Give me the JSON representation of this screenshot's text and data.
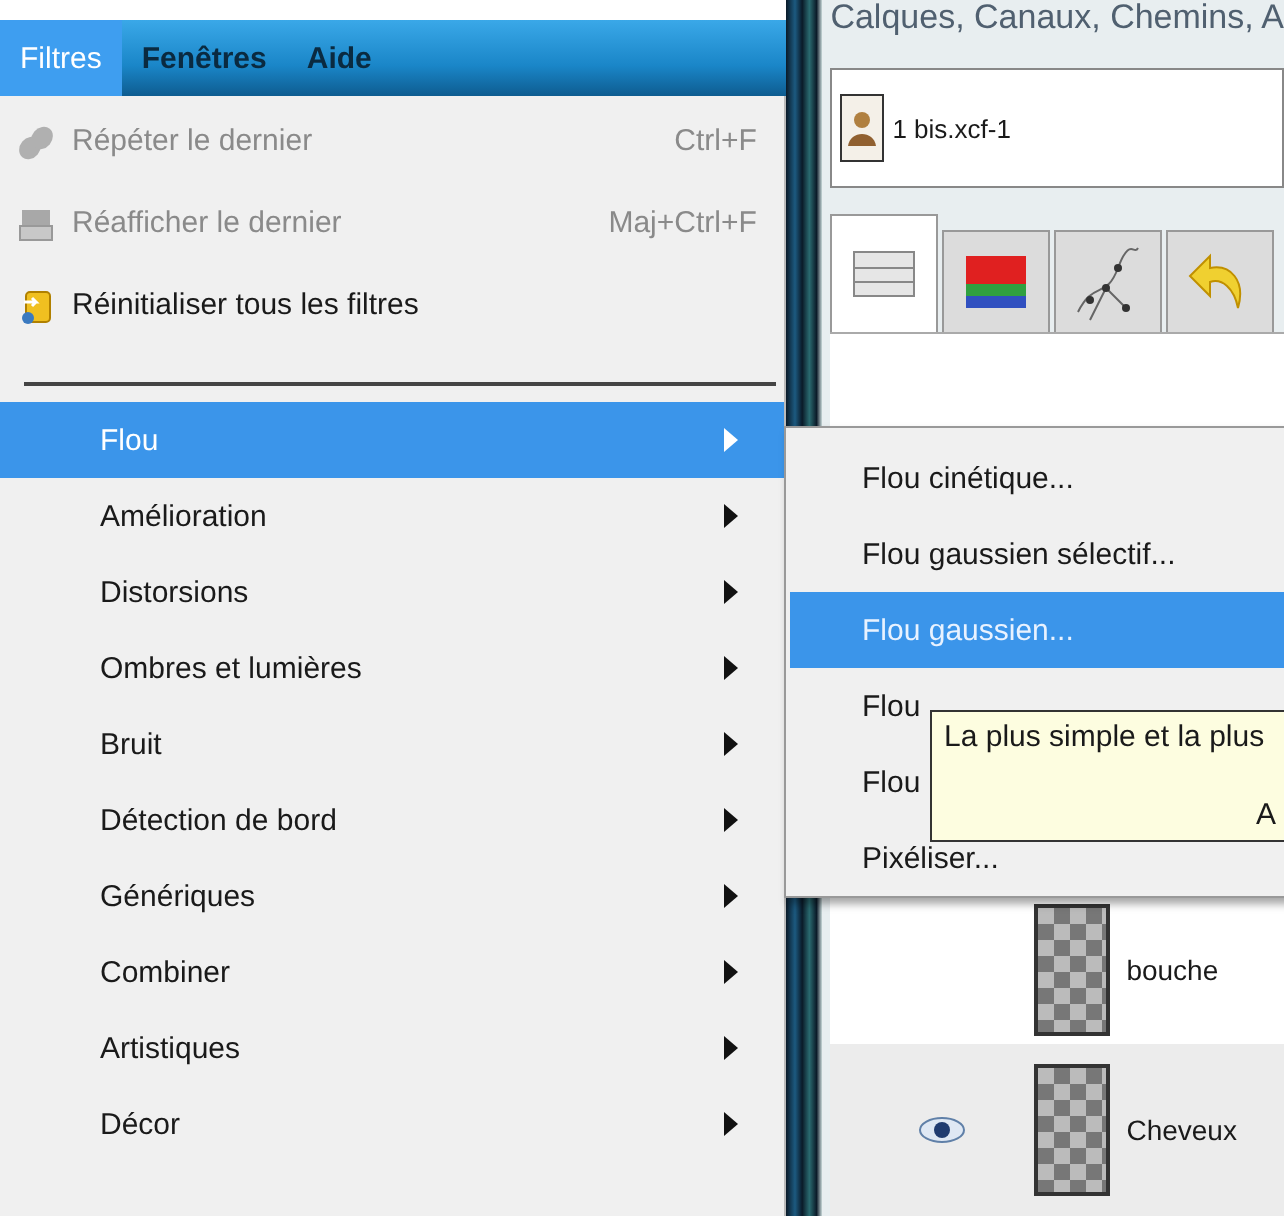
{
  "menubar": [
    {
      "label": "Filtres",
      "selected": true
    },
    {
      "label": "Fenêtres",
      "selected": false
    },
    {
      "label": "Aide",
      "selected": false
    }
  ],
  "menu": {
    "items": [
      {
        "kind": "command",
        "label": "Répéter le dernier",
        "shortcut": "Ctrl+F",
        "disabled": true
      },
      {
        "kind": "command",
        "label": "Réafficher le dernier",
        "shortcut": "Maj+Ctrl+F",
        "disabled": true
      },
      {
        "kind": "command",
        "label": "Réinitialiser tous les filtres",
        "disabled": false
      },
      {
        "kind": "separator"
      },
      {
        "kind": "submenu",
        "label": "Flou",
        "selected": true
      },
      {
        "kind": "submenu",
        "label": "Amélioration",
        "selected": false
      },
      {
        "kind": "submenu",
        "label": "Distorsions",
        "selected": false
      },
      {
        "kind": "submenu",
        "label": "Ombres et lumières",
        "selected": false
      },
      {
        "kind": "submenu",
        "label": "Bruit",
        "selected": false
      },
      {
        "kind": "submenu",
        "label": "Détection de bord",
        "selected": false
      },
      {
        "kind": "submenu",
        "label": "Génériques",
        "selected": false
      },
      {
        "kind": "submenu",
        "label": "Combiner",
        "selected": false
      },
      {
        "kind": "submenu",
        "label": "Artistiques",
        "selected": false
      },
      {
        "kind": "submenu",
        "label": "Décor",
        "selected": false
      }
    ]
  },
  "submenu": {
    "items": [
      {
        "label": "Flou cinétique...",
        "selected": false
      },
      {
        "label": "Flou gaussien sélectif...",
        "selected": false
      },
      {
        "label": "Flou gaussien...",
        "selected": true
      },
      {
        "label": "Flou",
        "selected": false
      },
      {
        "label": "Flou",
        "selected": false
      },
      {
        "label": "Pixéliser...",
        "selected": false
      }
    ]
  },
  "tooltip": {
    "lines": [
      "La plus simple et la plus",
      "A"
    ]
  },
  "dock": {
    "title": "Calques, Canaux, Chemins, A",
    "image": "1 bis.xcf-1",
    "tabs": [
      {
        "kind": "layers",
        "selected": true
      },
      {
        "kind": "channels",
        "selected": false
      },
      {
        "kind": "paths",
        "selected": false
      },
      {
        "kind": "undo",
        "selected": false
      }
    ],
    "layers": [
      {
        "name": "bouche",
        "visible": false
      },
      {
        "name": "Cheveux",
        "visible": true
      }
    ]
  }
}
